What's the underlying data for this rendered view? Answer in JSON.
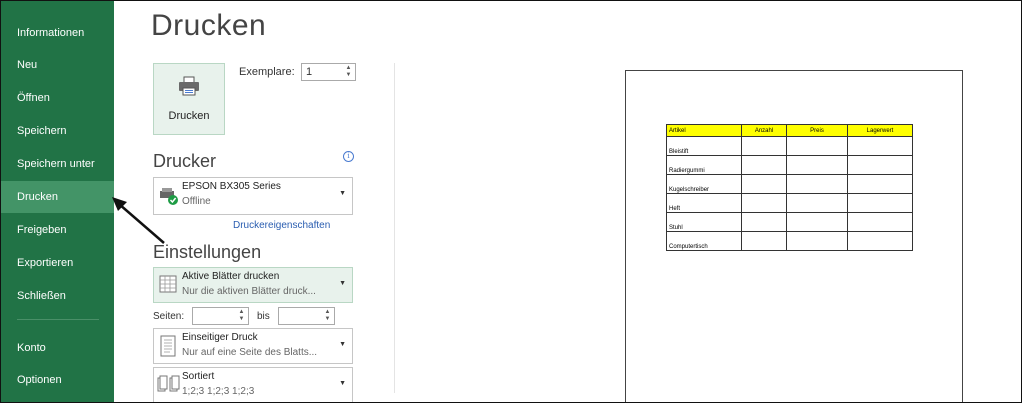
{
  "sidebar": {
    "items": [
      {
        "label": "Informationen"
      },
      {
        "label": "Neu"
      },
      {
        "label": "Öffnen"
      },
      {
        "label": "Speichern"
      },
      {
        "label": "Speichern unter"
      },
      {
        "label": "Drucken",
        "active": true
      },
      {
        "label": "Freigeben"
      },
      {
        "label": "Exportieren"
      },
      {
        "label": "Schließen"
      },
      {
        "label": "Konto"
      },
      {
        "label": "Optionen"
      }
    ]
  },
  "main": {
    "title": "Drucken",
    "print_button_label": "Drucken",
    "copies_label": "Exemplare:",
    "copies_value": "1",
    "printer_section_title": "Drucker",
    "printer": {
      "name": "EPSON BX305 Series",
      "status": "Offline"
    },
    "printer_properties_link": "Druckereigenschaften",
    "settings_section_title": "Einstellungen",
    "settings": [
      {
        "title": "Aktive Blätter drucken",
        "subtitle": "Nur die aktiven Blätter druck..."
      },
      {
        "title": "Einseitiger Druck",
        "subtitle": "Nur auf eine Seite des Blatts..."
      },
      {
        "title": "Sortiert",
        "subtitle": "1;2;3    1;2;3    1;2;3"
      }
    ],
    "pages_label": "Seiten:",
    "pages_to_label": "bis"
  },
  "preview": {
    "headers": [
      "Artikel",
      "Anzahl",
      "Preis",
      "Lagerwert"
    ],
    "rows": [
      "Bleistift",
      "Radiergummi",
      "Kugelschreiber",
      "Heft",
      "Stuhl",
      "Computertisch"
    ]
  },
  "colors": {
    "sidebar_bg": "#217346",
    "sidebar_active": "#439467",
    "header_fill": "#ffff00",
    "link": "#2a5db0"
  }
}
